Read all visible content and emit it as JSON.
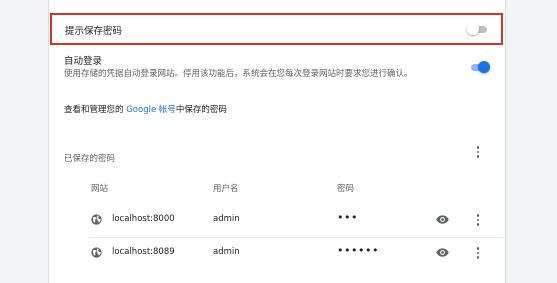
{
  "offer_to_save": {
    "label": "提示保存密码",
    "enabled": false
  },
  "auto_signin": {
    "title": "自动登录",
    "description": "使用存储的凭据自动登录网站。停用该功能后，系统会在您每次登录网站时要求您进行确认。",
    "enabled": true
  },
  "manage": {
    "prefix": "查看和管理您的 ",
    "link": "Google 帐号",
    "suffix": "中保存的密码"
  },
  "saved_passwords": {
    "header": "已保存的密码",
    "columns": {
      "website": "网站",
      "username": "用户名",
      "password": "密码"
    },
    "rows": [
      {
        "site": "localhost:8000",
        "username": "admin",
        "password_mask": "•••"
      },
      {
        "site": "localhost:8089",
        "username": "admin",
        "password_mask": "••••••"
      }
    ]
  },
  "colors": {
    "accent": "#1a73e8",
    "highlight_border": "#d93025"
  },
  "icons": [
    "globe-icon",
    "eye-icon",
    "more-vert-icon"
  ]
}
